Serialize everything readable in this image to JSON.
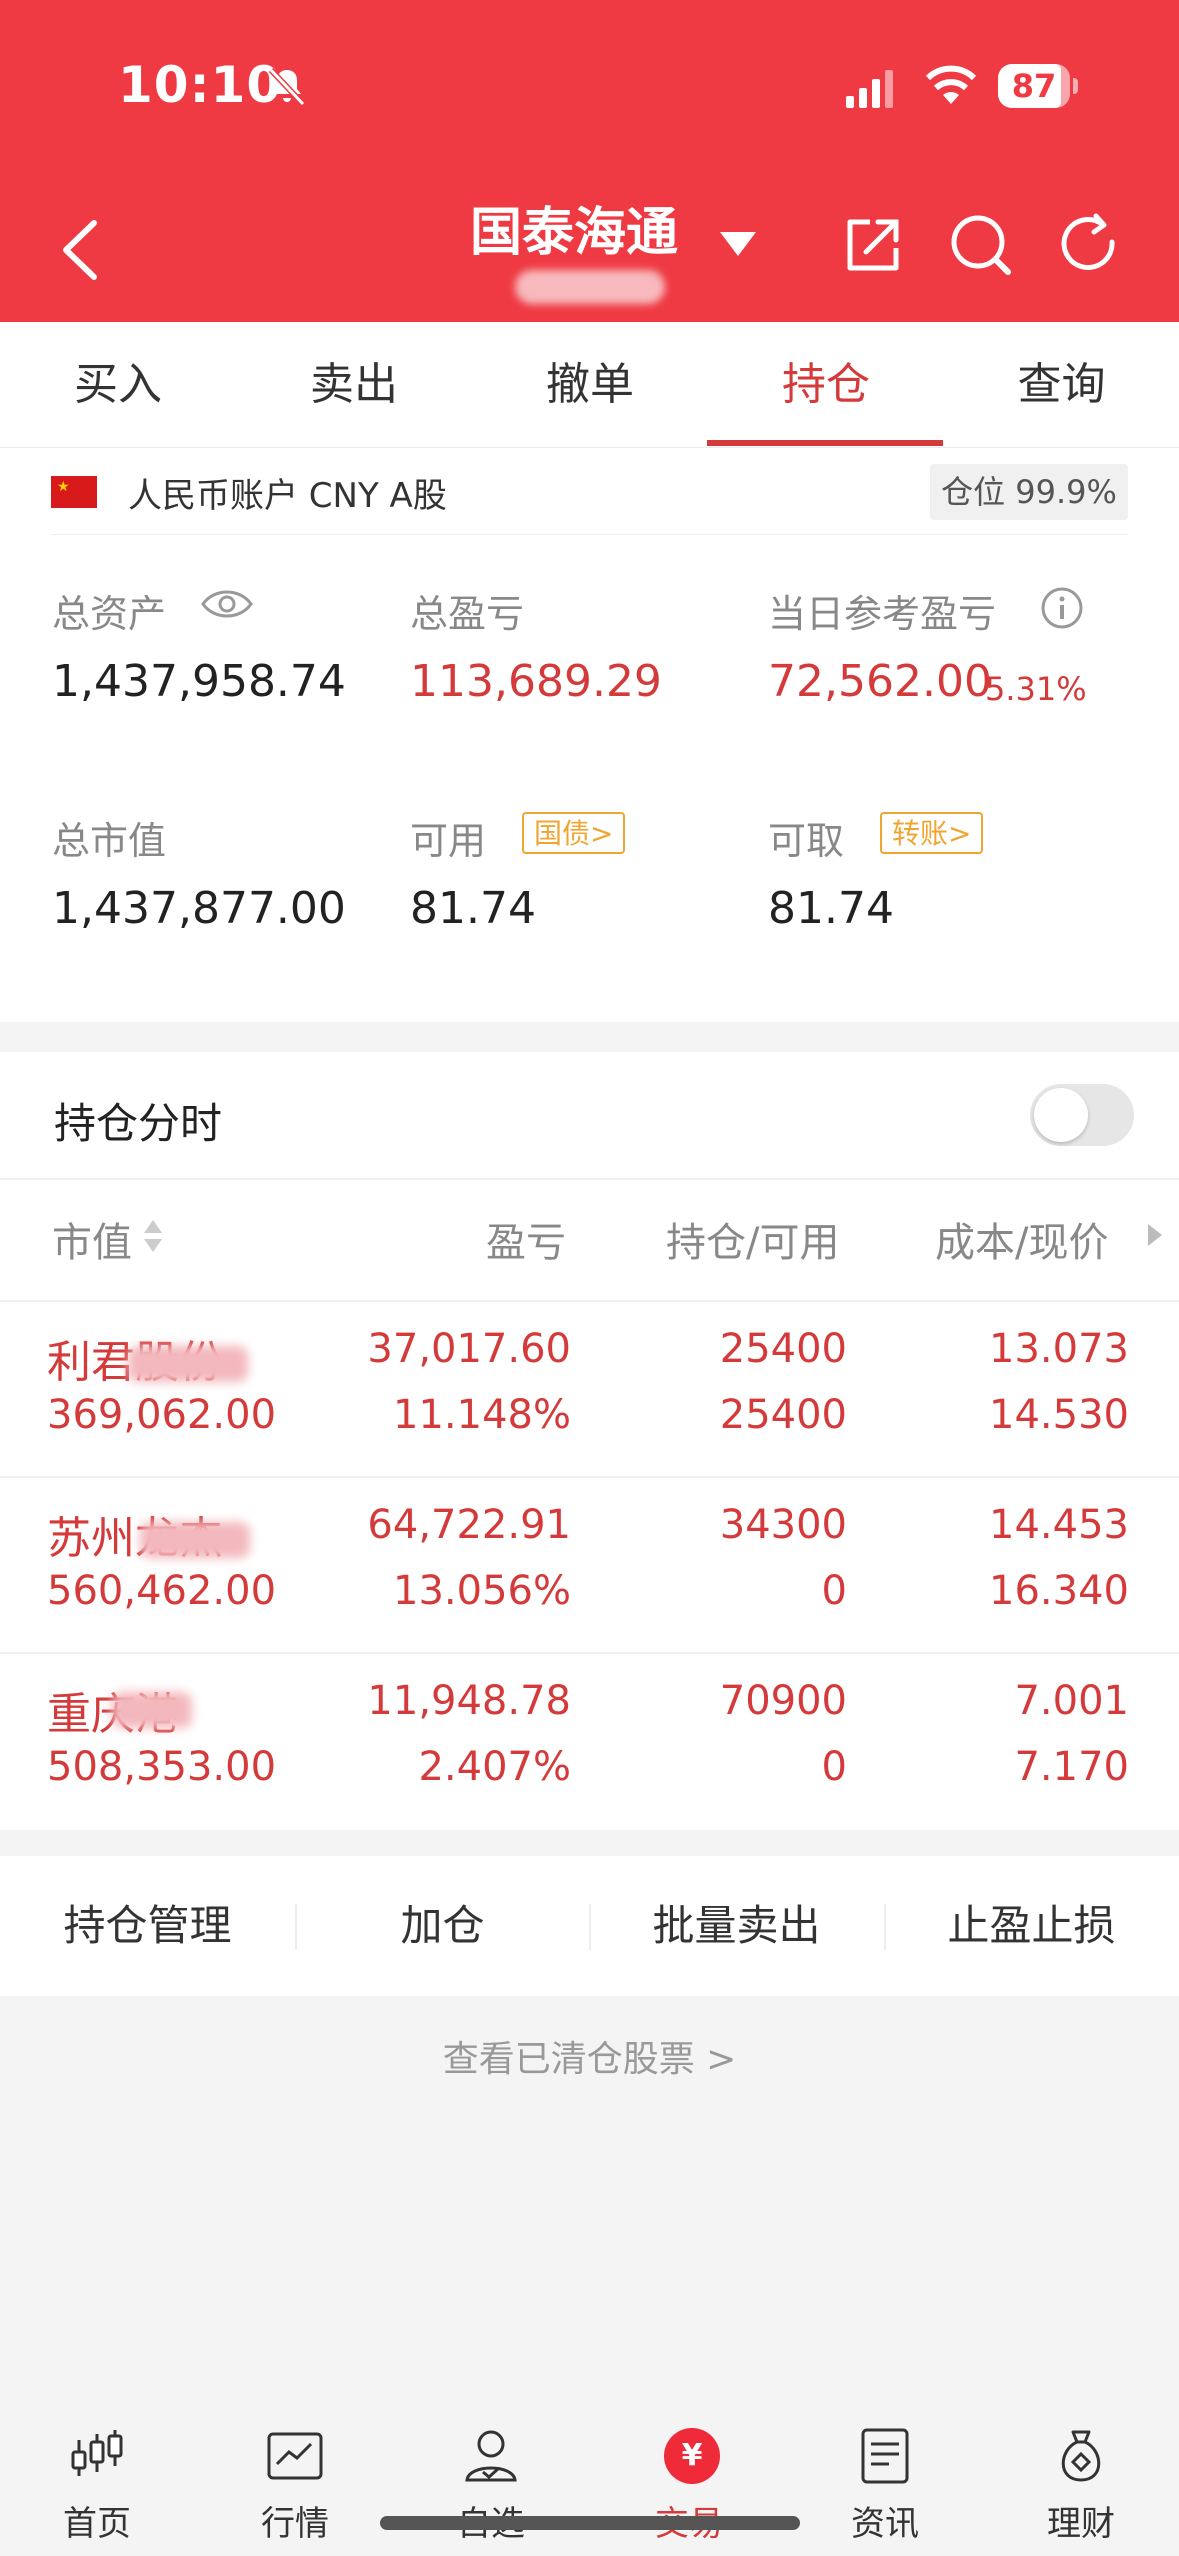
{
  "status_bar": {
    "time": "10:10",
    "battery": "87"
  },
  "header": {
    "title": "国泰海通"
  },
  "tabs": [
    {
      "label": "买入"
    },
    {
      "label": "卖出"
    },
    {
      "label": "撤单"
    },
    {
      "label": "持仓",
      "active": true
    },
    {
      "label": "查询"
    }
  ],
  "account": {
    "label": "人民币账户 CNY A股",
    "position_badge": "仓位 99.9%"
  },
  "metrics": {
    "total_assets_label": "总资产",
    "total_assets": "1,437,958.74",
    "total_pl_label": "总盈亏",
    "total_pl": "113,689.29",
    "daily_pl_label": "当日参考盈亏",
    "daily_pl": "72,562.00",
    "daily_pl_pct": "5.31%",
    "market_value_label": "总市值",
    "market_value": "1,437,877.00",
    "available_label": "可用",
    "available_tag": "国债>",
    "available": "81.74",
    "withdrawable_label": "可取",
    "withdrawable_tag": "转账>",
    "withdrawable": "81.74"
  },
  "holdings": {
    "title": "持仓分时",
    "columns": [
      "市值",
      "盈亏",
      "持仓/可用",
      "成本/现价"
    ],
    "rows": [
      {
        "name": "利君股份",
        "market_value": "369,062.00",
        "pl": "37,017.60",
        "pl_pct": "11.148%",
        "position": "25400",
        "available": "25400",
        "cost": "13.073",
        "price": "14.530"
      },
      {
        "name": "苏州龙杰",
        "market_value": "560,462.00",
        "pl": "64,722.91",
        "pl_pct": "13.056%",
        "position": "34300",
        "available": "0",
        "cost": "14.453",
        "price": "16.340"
      },
      {
        "name": "重庆港",
        "market_value": "508,353.00",
        "pl": "11,948.78",
        "pl_pct": "2.407%",
        "position": "70900",
        "available": "0",
        "cost": "7.001",
        "price": "7.170"
      }
    ]
  },
  "actions": [
    "持仓管理",
    "加仓",
    "批量卖出",
    "止盈止损"
  ],
  "cleared_link": "查看已清仓股票 >",
  "bottom_nav": [
    {
      "label": "首页",
      "icon": "candlestick-icon"
    },
    {
      "label": "行情",
      "icon": "chart-icon"
    },
    {
      "label": "自选",
      "icon": "user-check-icon"
    },
    {
      "label": "交易",
      "icon": "yen-icon",
      "active": true
    },
    {
      "label": "资讯",
      "icon": "document-icon"
    },
    {
      "label": "理财",
      "icon": "money-bag-icon"
    }
  ],
  "colors": {
    "brand_red": "#ef3a43",
    "gain_red": "#d43a3a",
    "tag_orange": "#f0a530"
  }
}
